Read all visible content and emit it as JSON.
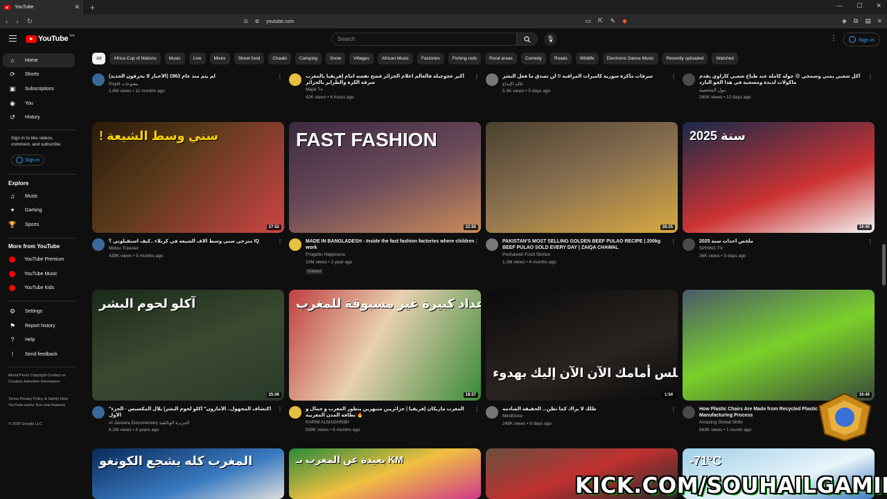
{
  "browser": {
    "tab_title": "YouTube",
    "url": "youtube.com"
  },
  "header": {
    "logo_text": "YouTube",
    "logo_country": "MA",
    "search_placeholder": "Search",
    "signin_label": "Sign in"
  },
  "sidebar": {
    "main": [
      {
        "label": "Home",
        "icon": "home-icon"
      },
      {
        "label": "Shorts",
        "icon": "shorts-icon"
      },
      {
        "label": "Subscriptions",
        "icon": "subscriptions-icon"
      },
      {
        "label": "You",
        "icon": "you-icon"
      },
      {
        "label": "History",
        "icon": "history-icon"
      }
    ],
    "signin_prompt": "Sign in to like videos, comment, and subscribe.",
    "signin_label": "Sign in",
    "explore_heading": "Explore",
    "explore": [
      {
        "label": "Music",
        "icon": "music-icon"
      },
      {
        "label": "Gaming",
        "icon": "gaming-icon"
      },
      {
        "label": "Sports",
        "icon": "sports-icon"
      }
    ],
    "more_heading": "More from YouTube",
    "more": [
      {
        "label": "YouTube Premium"
      },
      {
        "label": "YouTube Music"
      },
      {
        "label": "YouTube Kids"
      }
    ],
    "settings": [
      {
        "label": "Settings",
        "icon": "gear-icon"
      },
      {
        "label": "Report history",
        "icon": "flag-icon"
      },
      {
        "label": "Help",
        "icon": "help-icon"
      },
      {
        "label": "Send feedback",
        "icon": "feedback-icon"
      }
    ],
    "footer1": "About  Press  Copyright  Contact us  Creators  Advertise  Developers",
    "footer2": "Terms  Privacy  Policy & Safety  How YouTube works  Test new features",
    "copyright": "© 2025 Google LLC"
  },
  "chips": [
    "All",
    "Africa Cup of Nations",
    "Music",
    "Live",
    "Mixes",
    "Street food",
    "Chaabi",
    "Camping",
    "Snow",
    "Villages",
    "African Music",
    "Factories",
    "Fishing rods",
    "Rural areas",
    "Comedy",
    "Roads",
    "Wildlife",
    "Electronic Dance Music",
    "Recently uploaded",
    "Watched"
  ],
  "row0": [
    {
      "title": "لم يتم منذ عام 1963 (الأخبار لا يحرقون الحديد)",
      "channel": "Roykt مفتوحات",
      "meta": "1.6M views • 11 months ago"
    },
    {
      "title": "أكبر عجوجيلة فالعالم اعلام الجزائر فضح نفسه امام إفريقيا بالمغرب سرقة الكرة والطراير بالجزائر",
      "channel": "Majid Tv",
      "meta": "42K views • 6 hours ago"
    },
    {
      "title": "سرقات ماكرة سورية كاميرات المراقبة !! لن تصدق ما فعل البشر",
      "channel": "عالم الإبداع",
      "meta": "5.3K views • 5 days ago"
    },
    {
      "title": "أكل شعبي يمني وسمحي 😋 جولة كاملة عند طباخ شعبي كاراوي يقدم ماكولات لذيذة ومسجية في هذا الجو البارد",
      "channel": "مول الشخصية",
      "meta": "260K views • 12 days ago"
    }
  ],
  "row1": [
    {
      "title": "منزحي سني وسط آلاف الشيعة في كربلاء ..كيف استقبلوني ؟ IQ",
      "channel": "Midou Traveler",
      "meta": "438K views • 5 months ago",
      "duration": "27:52",
      "caption": "! سني وسط الشيعة"
    },
    {
      "title": "MADE IN BANGLADESH - Inside the fast fashion factories where children work",
      "channel": "Progetto Happiness",
      "meta": "10M views • 1 year ago",
      "duration": "22:50",
      "caption": "FAST FASHION",
      "badge": "Dubbed"
    },
    {
      "title": "PAKISTAN'S MOST SELLING GOLDEN BEEF PULAO RECIPE | 200kg BEEF PULAO SOLD EVERY DAY | ZAIQA CHAWAL",
      "channel": "Peshawari Food Stories",
      "meta": "1.2M views • 4 months ago",
      "duration": "26:25"
    },
    {
      "title": "ملخص أحداث سنة 2025",
      "channel": "SPHINX TV",
      "meta": "36K views • 3 days ago",
      "duration": "16:40",
      "caption": "سنة 2025"
    }
  ],
  "row2": [
    {
      "title": "\"اكتشاف المجهول.. الأمازون\" أكلو لحوم البشر| بلال المكسيس - الجزء الأول",
      "channel": "Al Jazeera Documentary الجزيرة الوثائقية",
      "meta": "6.2M views • 4 years ago",
      "duration": "25:06",
      "caption": "آكلو لحوم البشر"
    },
    {
      "title": "المغرب ماريكان إفريقيا | جزائريين متبهرين بتطور المغرب و جمال و نظافة المدن المغربية 🔥",
      "channel": "KARIM ALMAGHRIBI",
      "meta": "939K views • 8 months ago",
      "duration": "18:37",
      "caption": "جل جزائريين بأعداد كبيرة غير مسبوقة للمغرب"
    },
    {
      "title": "طلك لا يراك كما تظن... الحقيقة الصادمة",
      "channel": "MindGlow",
      "meta": "249K views • 9 days ago",
      "duration": "1:54",
      "caption": "تخيل هذا السر... قطك يجلس أمامك الآن الآن إليك بهدوء"
    },
    {
      "title": "How Plastic Chairs Are Made from Recycled Plastic Bags | Amazing Manufacturing Process",
      "channel": "Amazing Global Skills",
      "meta": "683K views • 1 month ago",
      "duration": "16:40"
    }
  ],
  "row3": [
    {
      "caption": "المغرب كله يشجع الكونغو"
    },
    {
      "caption": "بعيدة عن المغرب بـ KM"
    },
    {
      "caption": ""
    },
    {
      "caption": "-71°C"
    }
  ],
  "overlay": {
    "banner": "KICK.COM/SOUHAILGAMING",
    "logo_text": "SOUHAIL GAMING"
  },
  "colors": {
    "background": "#0f0f0f",
    "accent": "#ff0000",
    "link": "#3ea6ff"
  }
}
